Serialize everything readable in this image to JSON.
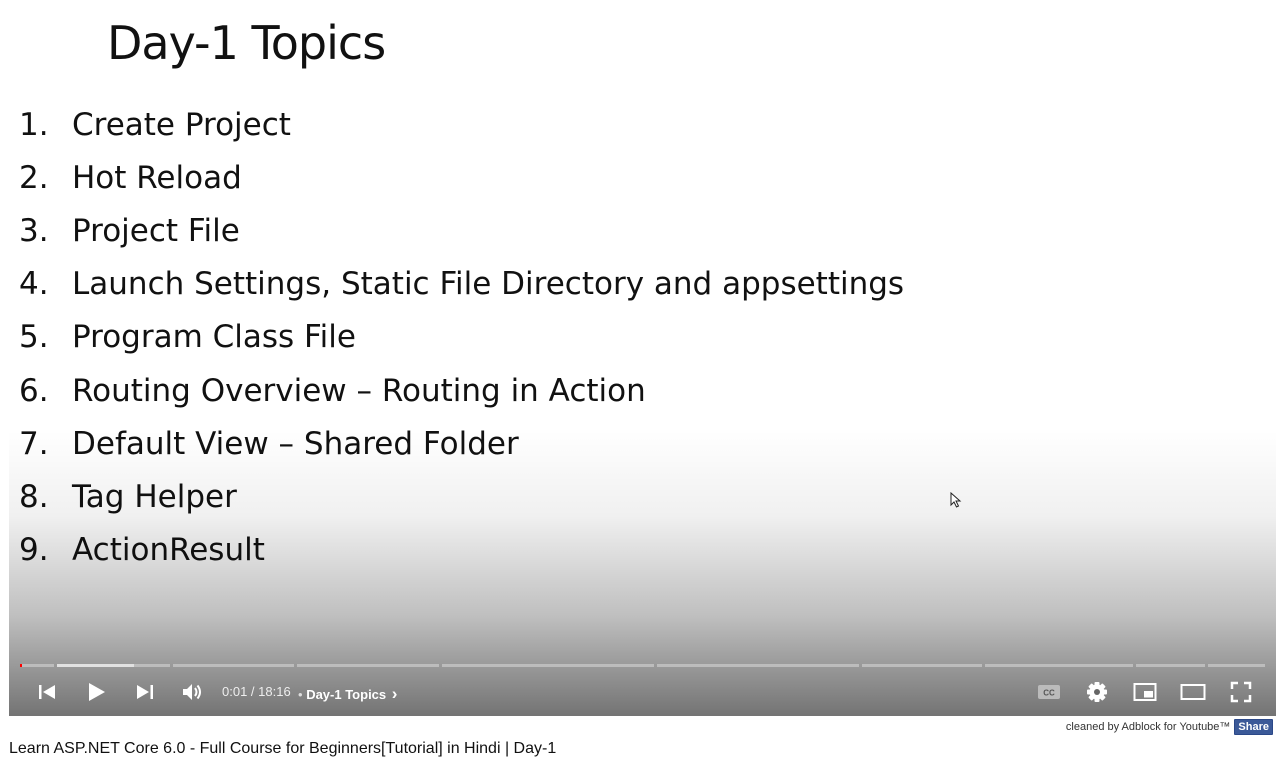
{
  "slide": {
    "title": "Day-1 Topics",
    "topics": [
      {
        "num": "1.",
        "text": "Create Project"
      },
      {
        "num": "2.",
        "text": "Hot Reload"
      },
      {
        "num": "3.",
        "text": "Project File"
      },
      {
        "num": "4.",
        "text": "Launch Settings, Static File Directory and appsettings"
      },
      {
        "num": "5.",
        "text": "Program Class File"
      },
      {
        "num": "6.",
        "text": "Routing Overview – Routing in Action"
      },
      {
        "num": "7.",
        "text": "Default View – Shared Folder"
      },
      {
        "num": "8.",
        "text": "Tag Helper"
      },
      {
        "num": "9.",
        "text": "ActionResult"
      }
    ]
  },
  "player": {
    "time_display": "0:01 / 18:16",
    "chapter_prefix": "•",
    "chapter_title": "Day-1 Topics",
    "chapter_chevron": "›",
    "played_fraction": 0.001,
    "buffered_fraction": 0.1,
    "icons": [
      "previous-icon",
      "play-icon",
      "next-icon",
      "volume-icon",
      "captions-icon",
      "settings-icon",
      "miniplayer-icon",
      "theater-icon",
      "fullscreen-icon"
    ],
    "accent_color": "#ff0000"
  },
  "adblock": {
    "text": "cleaned by Adblock for Youtube™",
    "share_label": "Share"
  },
  "video": {
    "title": "Learn ASP.NET Core 6.0 - Full Course for Beginners[Tutorial] in Hindi | Day-1"
  }
}
